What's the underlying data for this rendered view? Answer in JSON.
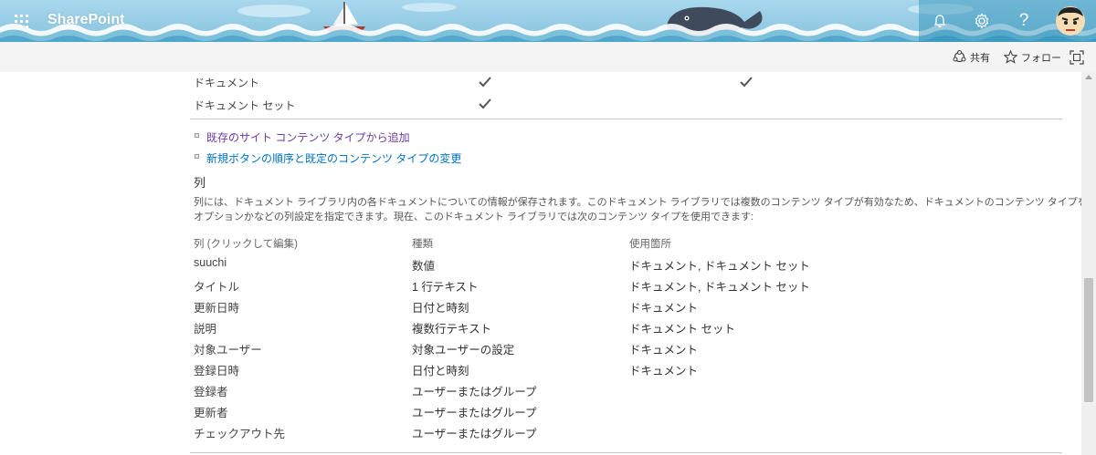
{
  "suite": {
    "app_name": "SharePoint",
    "icons": [
      "waffle-icon",
      "bell-icon",
      "gear-icon",
      "help-icon",
      "avatar"
    ],
    "help_label": "?",
    "colors": {
      "sky": "#a9d8ee",
      "wave": "#ffffff",
      "accent": "#2b8fb6"
    }
  },
  "commands": {
    "share": "共有",
    "follow": "フォロー"
  },
  "content_types": {
    "rows": [
      {
        "name": "ドキュメント",
        "checks": [
          true,
          true
        ]
      },
      {
        "name": "ドキュメント セット",
        "checks": [
          true,
          false
        ]
      }
    ]
  },
  "links": {
    "add_from_existing": "既存のサイト コンテンツ タイプから追加",
    "change_order": "新規ボタンの順序と既定のコンテンツ タイプの変更"
  },
  "columns_section": {
    "title": "列",
    "description_line1": "列には、ドキュメント ライブラリ内の各ドキュメントについての情報が保存されます。このドキュメント ライブラリでは複数のコンテンツ タイプが有効なため、ドキュメントのコンテンツ タイプを使用して、列に対する情報が必須かまたは",
    "description_line2": "オプションかなどの列設定を指定できます。現在、このドキュメント ライブラリでは次のコンテンツ タイプを使用できます:",
    "headers": {
      "column": "列 (クリックして編集)",
      "type": "種類",
      "used_in": "使用箇所"
    },
    "rows": [
      {
        "column": "suuchi",
        "type": "数値",
        "used_in": "ドキュメント, ドキュメント セット"
      },
      {
        "column": "タイトル",
        "type": "1 行テキスト",
        "used_in": "ドキュメント, ドキュメント セット"
      },
      {
        "column": "更新日時",
        "type": "日付と時刻",
        "used_in": "ドキュメント"
      },
      {
        "column": "説明",
        "type": "複数行テキスト",
        "used_in": "ドキュメント セット"
      },
      {
        "column": "対象ユーザー",
        "type": "対象ユーザーの設定",
        "used_in": "ドキュメント"
      },
      {
        "column": "登録日時",
        "type": "日付と時刻",
        "used_in": "ドキュメント"
      },
      {
        "column": "登録者",
        "type": "ユーザーまたはグループ",
        "used_in": ""
      },
      {
        "column": "更新者",
        "type": "ユーザーまたはグループ",
        "used_in": ""
      },
      {
        "column": "チェックアウト先",
        "type": "ユーザーまたはグループ",
        "used_in": ""
      }
    ]
  }
}
